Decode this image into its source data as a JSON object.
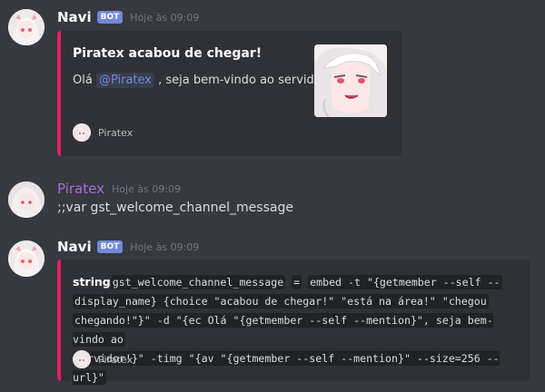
{
  "colors": {
    "background": "#36393f",
    "embed_bg": "#2f3136",
    "embed_accent": "#e91e63",
    "bot_tag": "#7289da",
    "mention": "#7289da",
    "user_piratex": "#a66fdc"
  },
  "messages": [
    {
      "author": "Navi",
      "bot_tag": "BOT",
      "timestamp": "Hoje às 09:09",
      "avatar_icon": "anime-avatar-icon",
      "embed": {
        "title": "Piratex acabou de chegar!",
        "desc_before": "Olá",
        "mention": "@Piratex",
        "desc_after": ", seja bem-vindo ao servidor!",
        "thumbnail_icon": "anime-girl-thumbnail",
        "footer_text": "Piratex"
      }
    },
    {
      "author": "Piratex",
      "timestamp": "Hoje às 09:09",
      "avatar_icon": "anime-avatar-icon",
      "content": ";;var gst_welcome_channel_message"
    },
    {
      "author": "Navi",
      "bot_tag": "BOT",
      "timestamp": "Hoje às 09:09",
      "avatar_icon": "anime-avatar-icon",
      "embed": {
        "label": "string",
        "var_name": "gst_welcome_channel_message",
        "equals": "=",
        "code_line1": "embed -t \"{getmember --self --",
        "code_line2": "display_name} {choice \"acabou de chegar!\" \"está na área!\" \"chegou",
        "code_line3": "chegando!\"}\" -d \"{ec Olá \"{getmember --self --mention}\", seja bem-vindo ao",
        "code_line4": "servidor!}\" -timg \"{av \"{getmember --self --mention}\" --size=256 --url}\"",
        "footer_text": "Piratex"
      }
    }
  ]
}
